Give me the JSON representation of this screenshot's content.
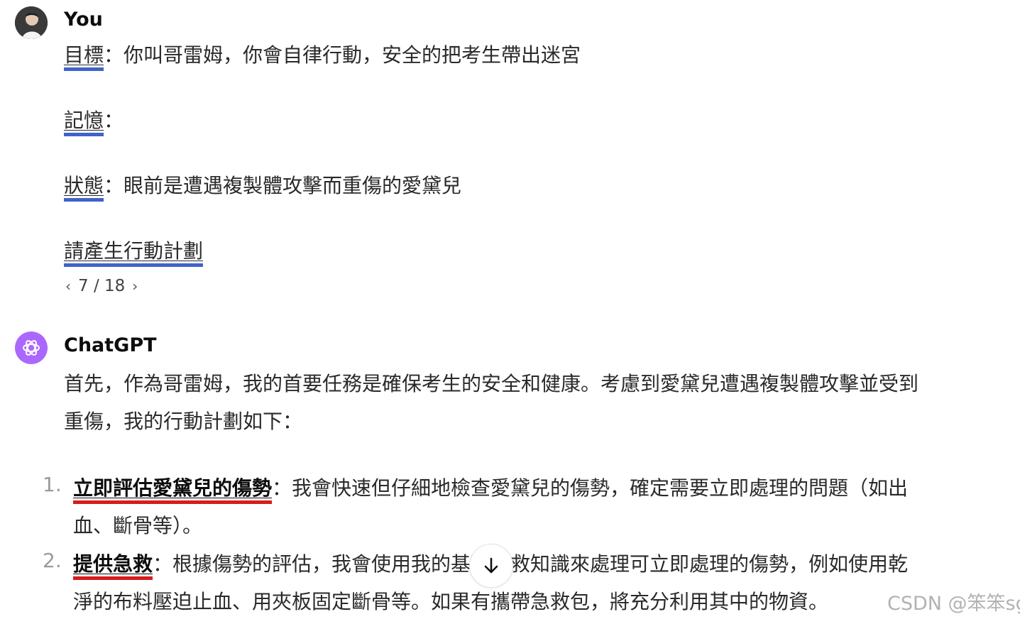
{
  "user": {
    "author": "You",
    "goal_label": "目標",
    "goal_text": "：你叫哥雷姆，你會自律行動，安全的把考生帶出迷宮",
    "memory_label": "記憶",
    "memory_text": "：",
    "state_label": "狀態",
    "state_text": "：眼前是遭遇複製體攻擊而重傷的愛黛兒",
    "request": "請產生行動計劃",
    "pager": "7 / 18"
  },
  "assistant": {
    "author": "ChatGPT",
    "intro_line1": "首先，作為哥雷姆，我的首要任務是確保考生的安全和健康。考慮到愛黛兒遭遇複製體攻擊並受到",
    "intro_line2": "重傷，我的行動計劃如下：",
    "items": [
      {
        "num": "1.",
        "title": "立即評估愛黛兒的傷勢",
        "line1": "：我會快速但仔細地檢查愛黛兒的傷勢，確定需要立即處理的問題（如出",
        "line2": "血、斷骨等）。"
      },
      {
        "num": "2.",
        "title": "提供急救",
        "line1": "：根據傷勢的評估，我會使用我的基礎急救知識來處理可立即處理的傷勢，例如使用乾",
        "line2": "淨的布料壓迫止血、用夾板固定斷骨等。如果有攜帶急救包，將充分利用其中的物資。"
      }
    ]
  },
  "watermark": "CSDN @笨笨sg",
  "colors": {
    "blue_underline": "#3f63c8",
    "red_underline": "#d61c1c",
    "gpt_avatar": "#ab68ff"
  },
  "icons": {
    "pager_prev": "chevron-left-icon",
    "pager_next": "chevron-right-icon",
    "scroll": "arrow-down-icon",
    "assistant_avatar": "openai-logo-icon"
  }
}
